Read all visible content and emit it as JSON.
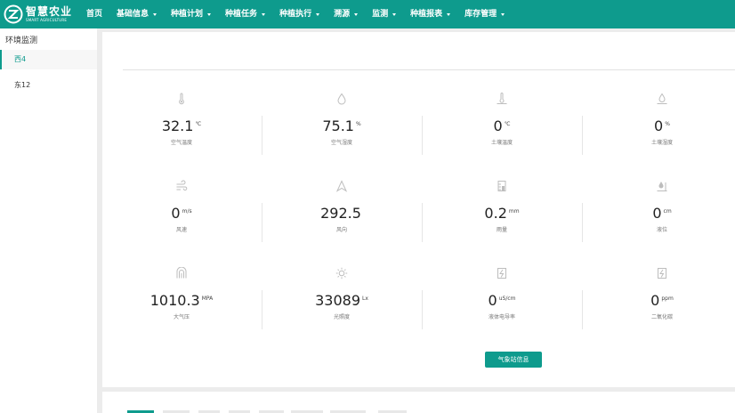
{
  "brand": {
    "name_cn": "智慧农业",
    "name_en": "SMART AGRICULTURE"
  },
  "nav": [
    {
      "label": "首页",
      "dropdown": false
    },
    {
      "label": "基础信息",
      "dropdown": true
    },
    {
      "label": "种植计划",
      "dropdown": true
    },
    {
      "label": "种植任务",
      "dropdown": true
    },
    {
      "label": "种植执行",
      "dropdown": true
    },
    {
      "label": "溯源",
      "dropdown": true
    },
    {
      "label": "监测",
      "dropdown": true
    },
    {
      "label": "种植报表",
      "dropdown": true
    },
    {
      "label": "库存管理",
      "dropdown": true
    }
  ],
  "sidebar": {
    "title": "环境监测",
    "items": [
      {
        "label": "西4",
        "active": true
      },
      {
        "label": "东12",
        "active": false
      }
    ]
  },
  "metrics": [
    {
      "icon": "thermometer-icon",
      "value": "32.1",
      "unit": "℃",
      "label": "空气温度"
    },
    {
      "icon": "droplet-icon",
      "value": "75.1",
      "unit": "%",
      "label": "空气湿度"
    },
    {
      "icon": "soil-thermometer-icon",
      "value": "0",
      "unit": "℃",
      "label": "土壤温度"
    },
    {
      "icon": "soil-moisture-icon",
      "value": "0",
      "unit": "%",
      "label": "土壤湿度"
    },
    {
      "icon": "wind-icon",
      "value": "0",
      "unit": "m/s",
      "label": "风速"
    },
    {
      "icon": "wind-direction-icon",
      "value": "292.5",
      "unit": "",
      "label": "风向"
    },
    {
      "icon": "rain-gauge-icon",
      "value": "0.2",
      "unit": "mm",
      "label": "雨量"
    },
    {
      "icon": "water-level-icon",
      "value": "0",
      "unit": "cm",
      "label": "液位"
    },
    {
      "icon": "pressure-icon",
      "value": "1010.3",
      "unit": "MPA",
      "label": "大气压"
    },
    {
      "icon": "sun-icon",
      "value": "33089",
      "unit": "Lx",
      "label": "光照度"
    },
    {
      "icon": "conductivity-icon",
      "value": "0",
      "unit": "uS/cm",
      "label": "液体电导率"
    },
    {
      "icon": "co2-icon",
      "value": "0",
      "unit": "ppm",
      "label": "二氧化碳"
    }
  ],
  "weather_button": "气象站信息",
  "colors": {
    "primary": "#0e9b8d",
    "icon": "#bdbdbd"
  }
}
